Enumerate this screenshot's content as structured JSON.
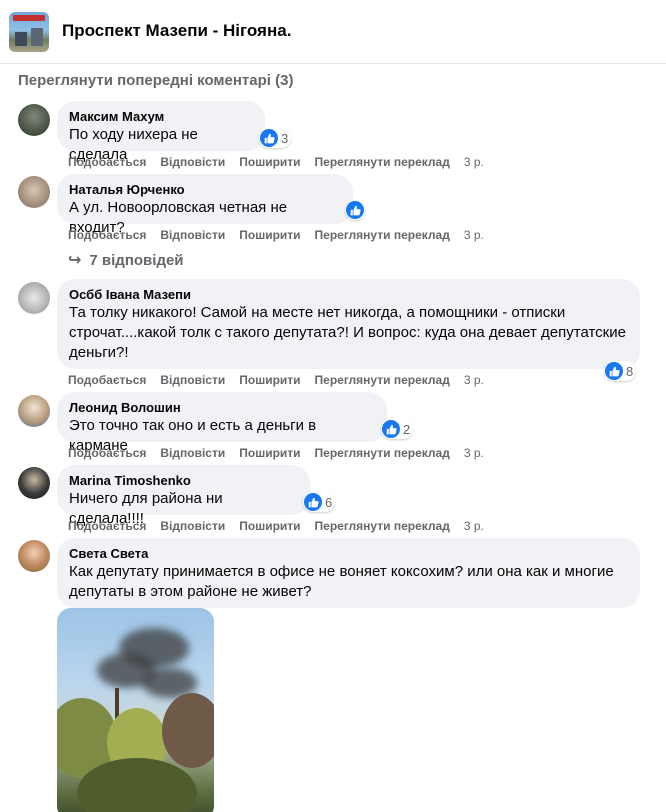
{
  "group": {
    "title": "Проспект Мазепи - Нігояна."
  },
  "prev_comments_label": "Переглянути попередні коментарі (3)",
  "actions": {
    "like": "Подобається",
    "reply": "Відповісти",
    "share": "Поширити",
    "translate": "Переглянути переклад"
  },
  "comments": [
    {
      "author": "Максим Махум",
      "text": "По ходу нихера не сделала",
      "reactions": "3",
      "time": "3 р."
    },
    {
      "author": "Наталья Юрченко",
      "text": "А ул. Новоорловская четная не входит?",
      "reactions": "",
      "time": "3 р.",
      "replies": "7 відповідей"
    },
    {
      "author": "Осбб Івана Мазепи",
      "text": "Та толку никакого! Самой на месте нет никогда, а помощники - отписки строчат....какой толк с такого депутата?! И вопрос: куда она девает депутатские деньги?!",
      "reactions": "8",
      "time": "3 р."
    },
    {
      "author": "Леонид Волошин",
      "text": "Это точно так оно и есть а деньги в кармане",
      "reactions": "2",
      "time": "3 р."
    },
    {
      "author": "Marina Timoshenko",
      "text": "Ничего для района ни сделала!!!!",
      "reactions": "6",
      "time": "3 р."
    },
    {
      "author": "Света Света",
      "text": "Как депутату принимается в офисе не воняет коксохим? или она как и многие депутаты в этом районе не живет?"
    }
  ],
  "colors": {
    "like_blue": "#1877f2",
    "bubble_bg": "#f0f2f5",
    "meta_gray": "#65676b"
  }
}
